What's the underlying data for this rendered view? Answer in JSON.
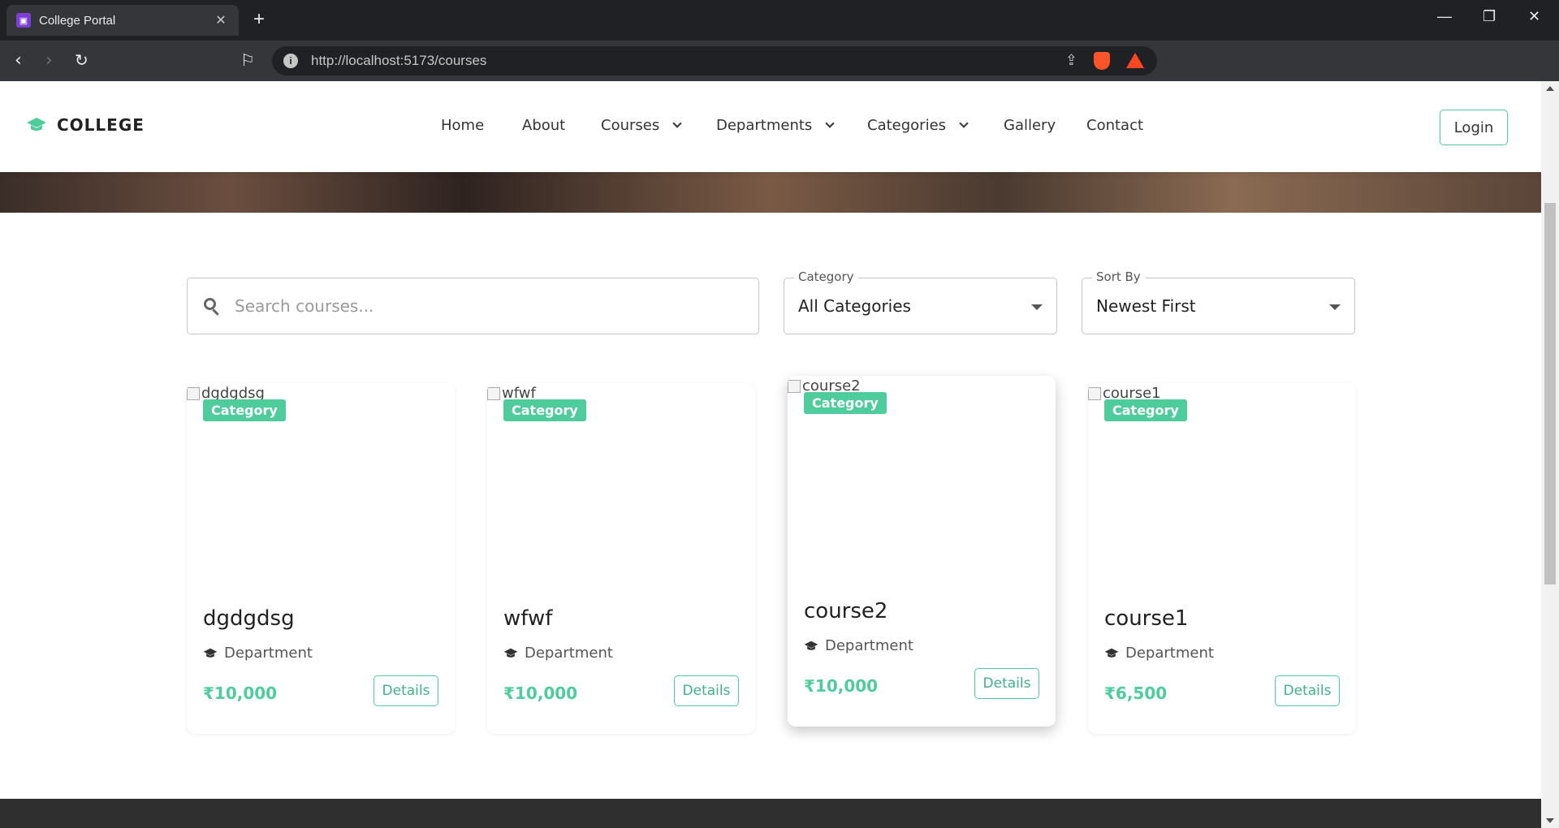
{
  "browser": {
    "tab_title": "College Portal",
    "url": "http://localhost:5173/courses"
  },
  "site": {
    "brand": "COLLEGE",
    "nav": [
      {
        "label": "Home"
      },
      {
        "label": "About"
      },
      {
        "label": "Courses"
      },
      {
        "label": "Departments"
      },
      {
        "label": "Categories"
      },
      {
        "label": "Gallery"
      },
      {
        "label": "Contact"
      }
    ],
    "login_label": "Login",
    "accent_color": "#4ecc9b"
  },
  "filters": {
    "search_placeholder": "Search courses...",
    "category": {
      "label": "Category",
      "value": "All Categories"
    },
    "sort": {
      "label": "Sort By",
      "value": "Newest First"
    }
  },
  "courses": [
    {
      "image_alt": "dgdgdsg",
      "badge": "Category",
      "title": "dgdgdsg",
      "department": "Department",
      "price": "₹10,000",
      "details_label": "Details"
    },
    {
      "image_alt": "wfwf",
      "badge": "Category",
      "title": "wfwf",
      "department": "Department",
      "price": "₹10,000",
      "details_label": "Details"
    },
    {
      "image_alt": "course2",
      "badge": "Category",
      "title": "course2",
      "department": "Department",
      "price": "₹10,000",
      "details_label": "Details"
    },
    {
      "image_alt": "course1",
      "badge": "Category",
      "title": "course1",
      "department": "Department",
      "price": "₹6,500",
      "details_label": "Details"
    }
  ]
}
